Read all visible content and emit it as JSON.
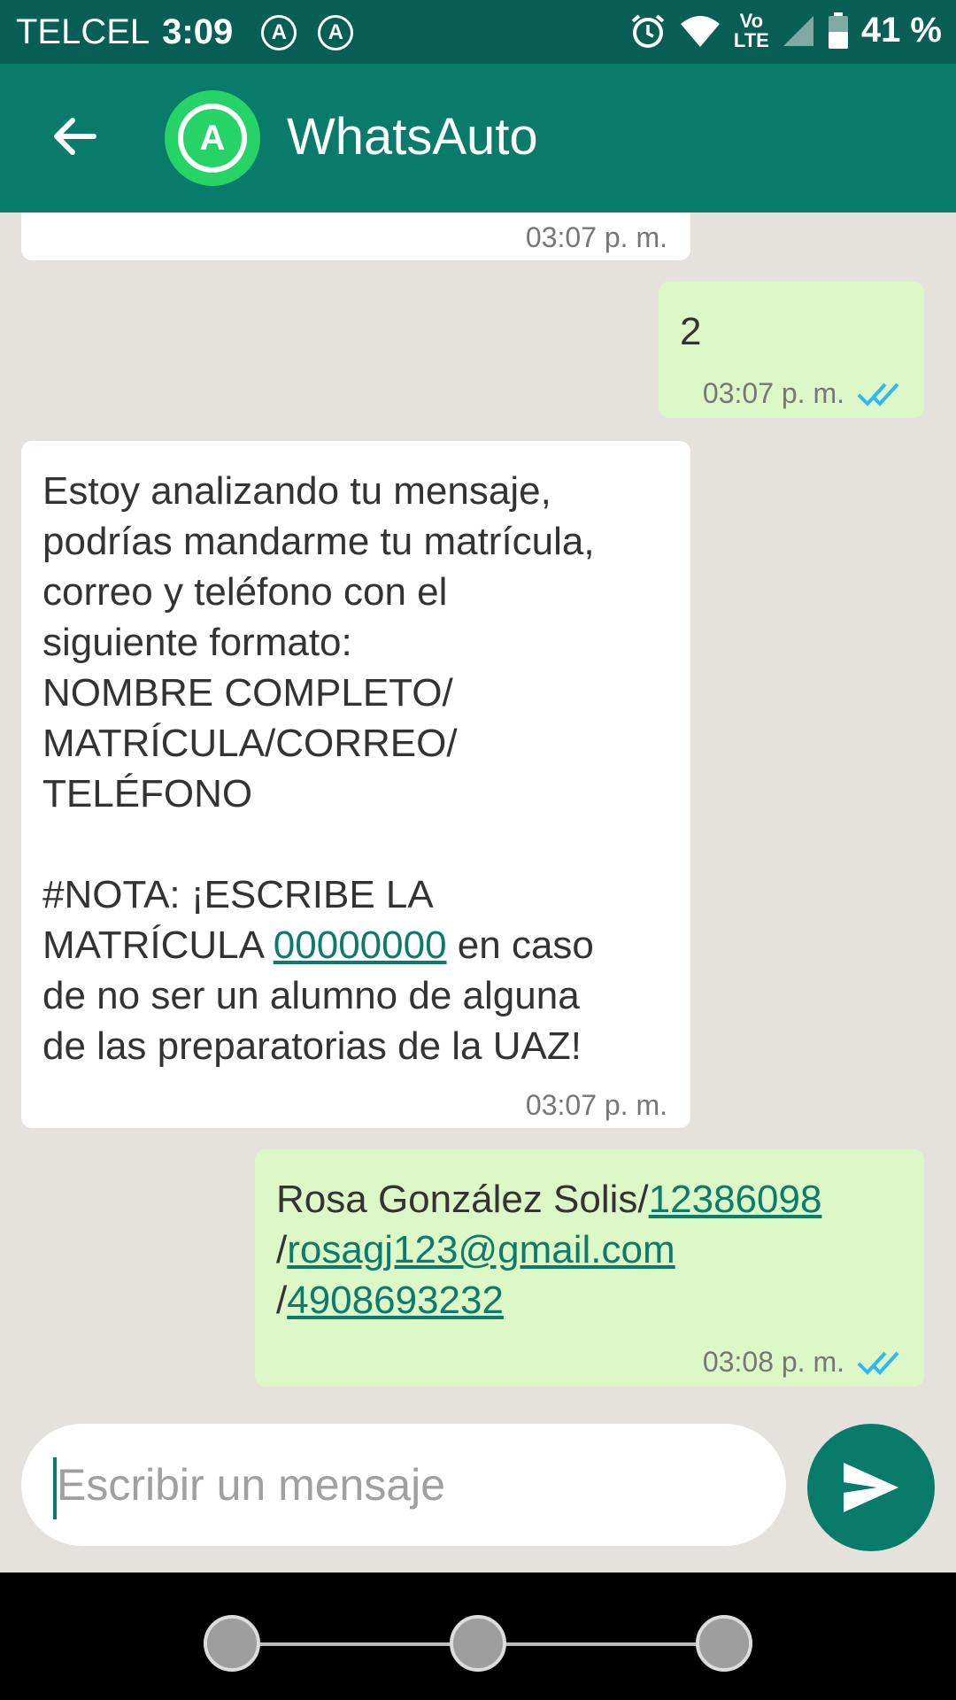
{
  "status_bar": {
    "carrier": "TELCEL",
    "time": "3:09",
    "notif_icons": [
      "A",
      "A"
    ],
    "volte_top": "Vo",
    "volte_bottom": "LTE",
    "battery": "41 %"
  },
  "app_bar": {
    "title": "WhatsAuto",
    "logo_letter": "A"
  },
  "messages": [
    {
      "direction": "in",
      "text": "",
      "time": "03:07 p. m."
    },
    {
      "direction": "out",
      "text": "2",
      "time": "03:07 p. m.",
      "status": "read"
    },
    {
      "direction": "in",
      "text_part1": "Estoy analizando tu mensaje,\npodrías mandarme tu matrícula,\ncorreo y teléfono con el\nsiguiente formato:\nNOMBRE COMPLETO/\nMATRÍCULA/CORREO/\nTELÉFONO\n\n#NOTA: ¡ESCRIBE LA\nMATRÍCULA ",
      "link": "00000000",
      "text_part2": " en caso\nde no ser un alumno de alguna\nde las preparatorias de la UAZ!",
      "time": "03:07 p. m."
    },
    {
      "direction": "out",
      "name": "Rosa González Solis/",
      "id_link": "12386098",
      "slash1": "/",
      "email_link": "rosagj123@gmail.com",
      "slash2": "/",
      "phone_link": "4908693232",
      "time": "03:08 p. m.",
      "status": "read"
    }
  ],
  "composer": {
    "placeholder": "Escribir un mensaje"
  },
  "colors": {
    "status_bar": "#075e54",
    "app_bar": "#087b6b",
    "logo": "#25d366",
    "chat_bg": "#e5e1dc",
    "outgoing_bubble": "#dcf8c6",
    "incoming_bubble": "#ffffff",
    "read_ticks": "#34b7f1"
  }
}
